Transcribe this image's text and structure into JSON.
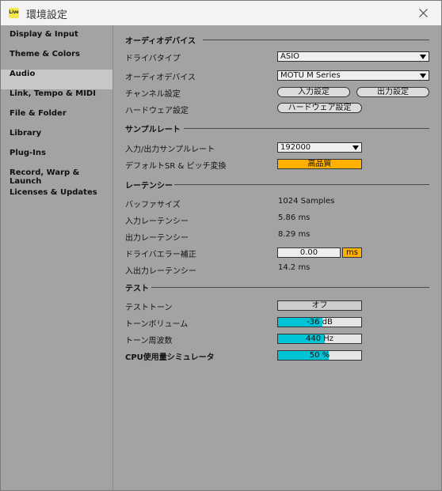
{
  "window": {
    "app_logo": "Live",
    "title": "環境設定",
    "close_icon": "close-icon"
  },
  "sidebar": {
    "items": [
      {
        "label": "Display & Input"
      },
      {
        "label": "Theme & Colors"
      },
      {
        "label": "Audio",
        "active": true
      },
      {
        "label": "Link, Tempo & MIDI"
      },
      {
        "label": "File & Folder"
      },
      {
        "label": "Library"
      },
      {
        "label": "Plug-Ins"
      },
      {
        "label": "Record, Warp & Launch"
      },
      {
        "label": "Licenses & Updates"
      }
    ]
  },
  "audio_device": {
    "title": "オーディオデバイス",
    "driver_type_label": "ドライバタイプ",
    "driver_type_value": "ASIO",
    "device_label": "オーディオデバイス",
    "device_value": "MOTU M Series",
    "channel_label": "チャンネル設定",
    "input_config_button": "入力設定",
    "output_config_button": "出力設定",
    "hardware_label": "ハードウェア設定",
    "hardware_button": "ハードウェア設定"
  },
  "sample_rate": {
    "title": "サンプルレート",
    "io_rate_label": "入力/出力サンプルレート",
    "io_rate_value": "192000",
    "default_sr_label": "デフォルトSR & ピッチ変換",
    "default_sr_value": "高品質"
  },
  "latency": {
    "title": "レーテンシー",
    "buffer_label": "バッファサイズ",
    "buffer_value": "1024 Samples",
    "input_latency_label": "入力レーテンシー",
    "input_latency_value": "5.86 ms",
    "output_latency_label": "出力レーテンシー",
    "output_latency_value": "8.29 ms",
    "driver_error_label": "ドライバエラー補正",
    "driver_error_value": "0.00",
    "driver_error_unit": "ms",
    "overall_label": "入出力レーテンシー",
    "overall_value": "14.2 ms"
  },
  "test": {
    "title": "テスト",
    "tone_label": "テストトーン",
    "tone_value": "オフ",
    "volume_label": "トーンボリューム",
    "volume_value": "-36 dB",
    "volume_fill": 0.53,
    "freq_label": "トーン周波数",
    "freq_value": "440 Hz",
    "freq_fill": 0.56,
    "cpu_label": "CPU使用量シミュレータ",
    "cpu_value": "50 %",
    "cpu_fill": 0.61
  },
  "colors": {
    "accent_orange": "#ffb000",
    "accent_cyan": "#00c3d6",
    "panel_bg": "#a3a3a3"
  }
}
